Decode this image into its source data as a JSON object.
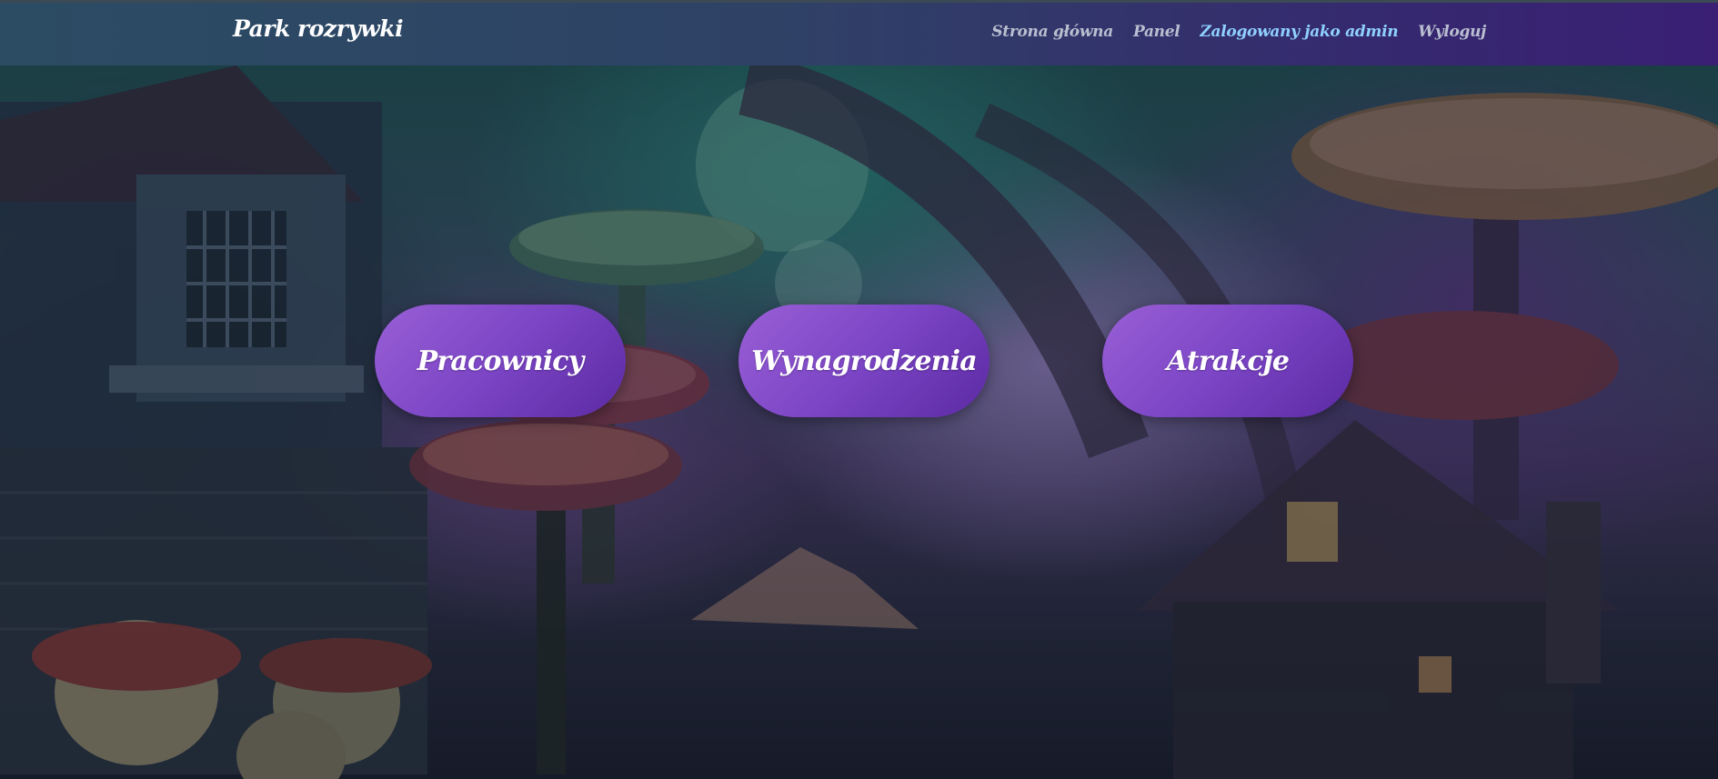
{
  "navbar": {
    "brand": "Park rozrywki",
    "links": [
      {
        "label": "Strona główna"
      },
      {
        "label": "Panel"
      },
      {
        "label": "Zalogowany jako admin"
      },
      {
        "label": "Wyloguj"
      }
    ]
  },
  "actions": [
    {
      "label": "Pracownicy"
    },
    {
      "label": "Wynagrodzenia"
    },
    {
      "label": "Atrakcje"
    }
  ],
  "colors": {
    "navbar_start": "#2b4c63",
    "navbar_end": "#3a1f74",
    "button_purple": "#7b45c5",
    "highlight_link": "#8fd0ff"
  },
  "background": {
    "icon": "fantasy-mushroom-village-illustration"
  }
}
